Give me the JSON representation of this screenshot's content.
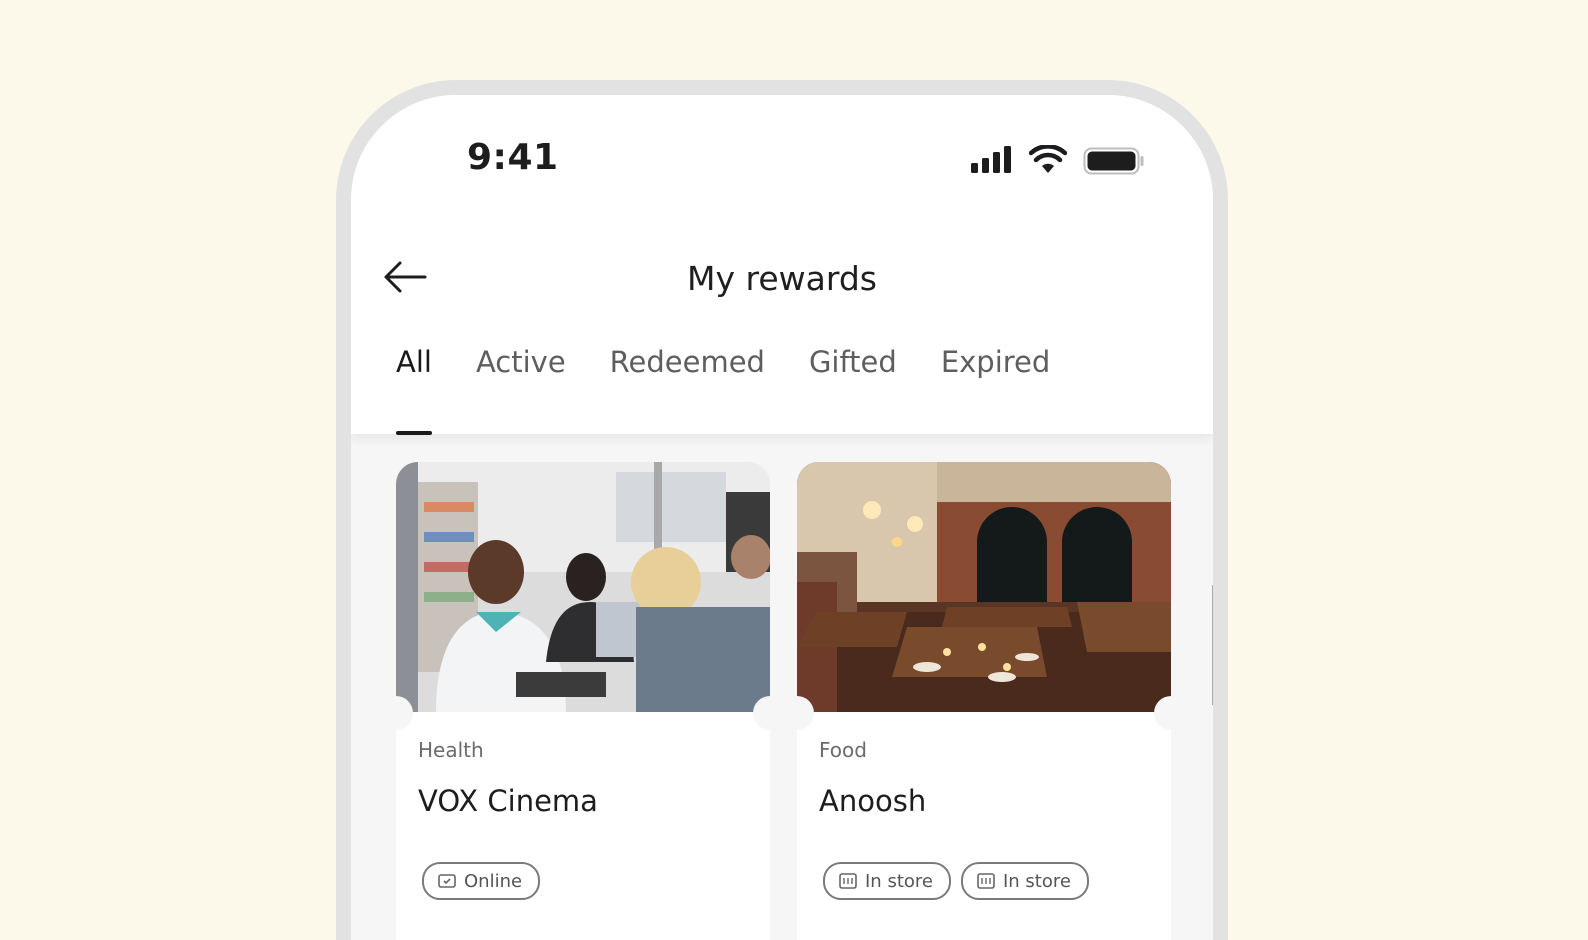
{
  "status_bar": {
    "time": "9:41"
  },
  "header": {
    "title": "My rewards"
  },
  "tabs": [
    {
      "label": "All",
      "active": true
    },
    {
      "label": "Active",
      "active": false
    },
    {
      "label": "Redeemed",
      "active": false
    },
    {
      "label": "Gifted",
      "active": false
    },
    {
      "label": "Expired",
      "active": false
    }
  ],
  "cards": [
    {
      "category": "Health",
      "name": "VOX Cinema",
      "tags": [
        "Online"
      ]
    },
    {
      "category": "Food",
      "name": "Anoosh",
      "tags": [
        "In store",
        "In store"
      ]
    }
  ],
  "colors": {
    "background": "#fdf9ea",
    "text": "#1d1d1f",
    "muted": "#6b6b6b"
  }
}
